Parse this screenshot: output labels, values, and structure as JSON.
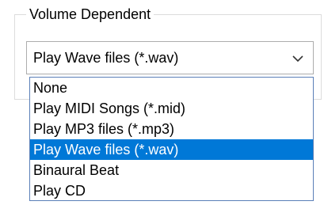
{
  "group": {
    "title": "Volume Dependent"
  },
  "combo": {
    "selected_value": "Play Wave files (*.wav)",
    "arrow_icon": "chevron-down-icon"
  },
  "dropdown": {
    "options": [
      {
        "label": "None"
      },
      {
        "label": "Play MIDI Songs (*.mid)"
      },
      {
        "label": "Play MP3 files (*.mp3)"
      },
      {
        "label": "Play Wave files (*.wav)",
        "selected": true
      },
      {
        "label": "Binaural Beat"
      },
      {
        "label": "Play CD"
      }
    ]
  },
  "colors": {
    "highlight": "#0078d7",
    "highlight_text": "#ffffff",
    "dropdown_border": "#5a7fb8",
    "combo_border": "#adadad",
    "groupbox_border": "#dcdcdc"
  }
}
